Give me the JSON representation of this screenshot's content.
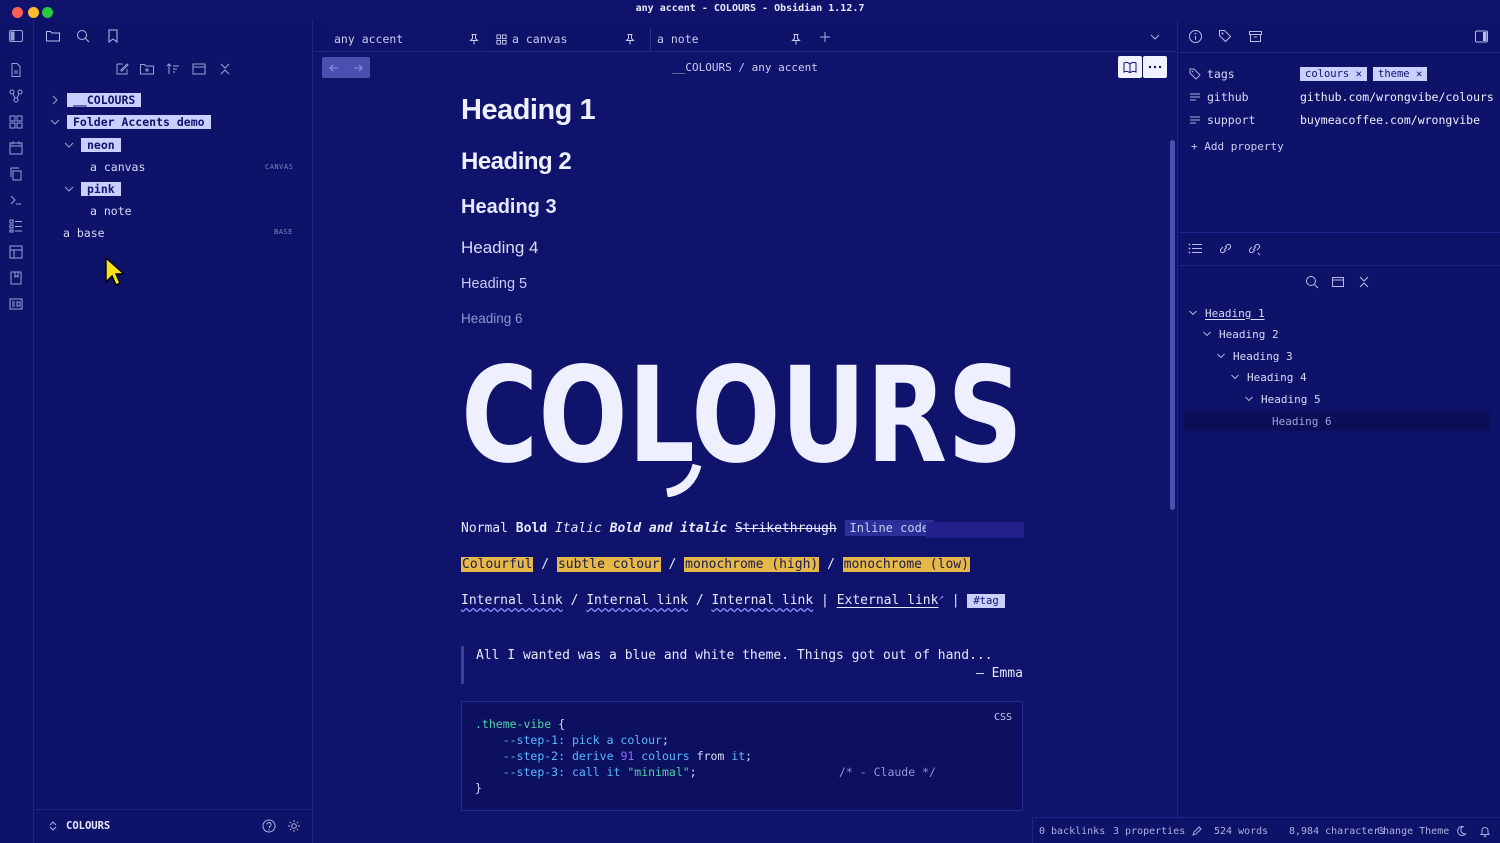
{
  "window": {
    "title": "any accent - COLOURS - Obsidian 1.12.7"
  },
  "tabs": [
    {
      "label": "any accent",
      "icon": "pin-icon"
    },
    {
      "label": "a canvas",
      "icon": "pin-icon"
    },
    {
      "label": "a note",
      "icon": "pin-icon"
    }
  ],
  "breadcrumb": {
    "folder": "__COLOURS",
    "sep": "/",
    "file": "any accent"
  },
  "file_tree": {
    "root_folder": "__COLOURS",
    "demo_folder": "Folder Accents demo",
    "neon_folder": "neon",
    "canvas_file": "a canvas",
    "canvas_tag": "CANVAS",
    "pink_folder": "pink",
    "note_file": "a note",
    "base_file": "a base",
    "base_tag": "BASE"
  },
  "vault": {
    "name": "COLOURS"
  },
  "note": {
    "h1": "Heading 1",
    "h2": "Heading 2",
    "h3": "Heading 3",
    "h4": "Heading 4",
    "h5": "Heading 5",
    "h6": "Heading 6",
    "logo_text": "COLOURS",
    "fmt_normal": "Normal",
    "fmt_bold": "Bold",
    "fmt_italic": "Italic",
    "fmt_bolditalic": "Bold and italic",
    "fmt_strike": "Strikethrough",
    "fmt_code": "Inline code",
    "hl_colourful": "Colourful",
    "hl_subtle": "subtle colour",
    "hl_mono_high": "monochrome (high)",
    "hl_mono_low": "monochrome (low)",
    "slash": "/",
    "pipe": "|",
    "link_internal": "Internal link",
    "link_external": "External link",
    "tag": "#tag",
    "quote": "All I wanted was a blue and white theme. Things got out of hand...",
    "quote_author": "— Emma",
    "code_lang": "CSS",
    "code_selector": ".theme-vibe",
    "code_brace_open": "{",
    "code_brace_close": "}",
    "code_p1": "--step-1:",
    "code_v1": "pick a colour",
    "code_p2": "--step-2:",
    "code_v2a": "derive",
    "code_v2num": "91",
    "code_v2b": "colours",
    "code_v2from": "from",
    "code_v2it": "it",
    "code_p3": "--step-3:",
    "code_v3a": "call it",
    "code_v3str": "\"minimal\"",
    "code_comment": "/* - Claude */",
    "code_semicolon": ";"
  },
  "properties": {
    "tags_label": "tags",
    "tag1": "colours",
    "tag2": "theme",
    "github_label": "github",
    "github_value": "github.com/wrongvibe/colours",
    "support_label": "support",
    "support_value": "buymeacoffee.com/wrongvibe",
    "add_property": "+ Add property"
  },
  "outline": {
    "h1": "Heading 1",
    "h2": "Heading 2",
    "h3": "Heading 3",
    "h4": "Heading 4",
    "h5": "Heading 5",
    "h6": "Heading 6"
  },
  "status": {
    "backlinks": "0 backlinks",
    "properties": "3 properties",
    "words": "524 words",
    "characters": "8,984 characters",
    "change_theme": "Change Theme"
  },
  "colors": {
    "background": "#10136b",
    "accent_chip": "#c9d0ff",
    "highlight": "#e6b84a",
    "link_underline": "#8a93ff"
  }
}
